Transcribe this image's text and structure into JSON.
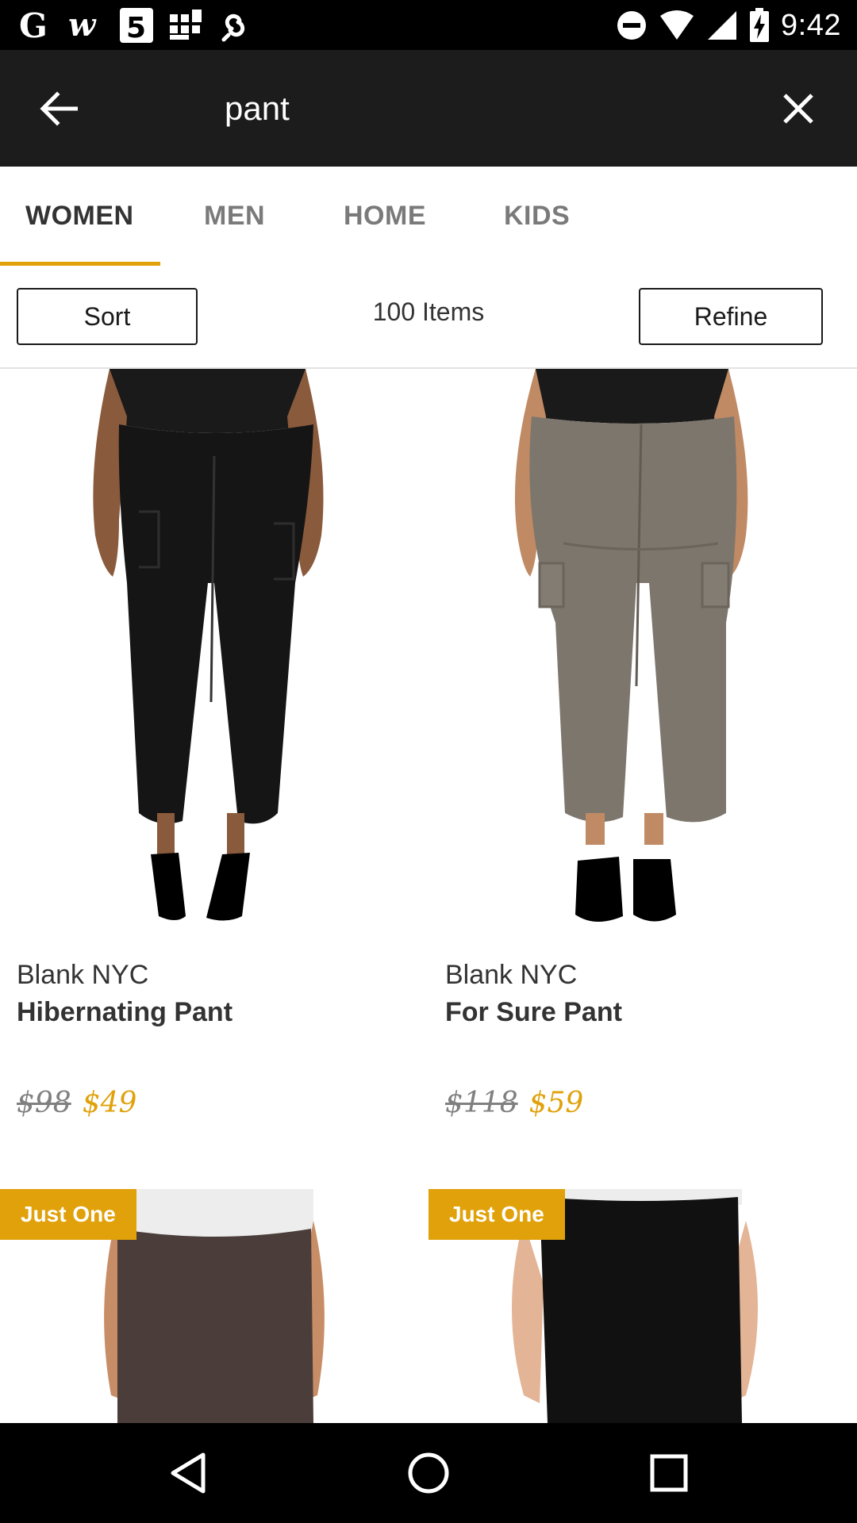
{
  "status_bar": {
    "time": "9:42",
    "left_icons": [
      "google-icon",
      "wordpress-icon",
      "channel5-icon",
      "grid-app-icon",
      "link-app-icon"
    ],
    "right_icons": [
      "do-not-disturb-icon",
      "wifi-icon",
      "signal-icon",
      "battery-charging-icon"
    ]
  },
  "toolbar": {
    "query": "pant"
  },
  "tabs": [
    {
      "label": "WOMEN",
      "active": true
    },
    {
      "label": "MEN",
      "active": false
    },
    {
      "label": "HOME",
      "active": false
    },
    {
      "label": "KIDS",
      "active": false
    }
  ],
  "filter": {
    "sort_label": "Sort",
    "items_count": "100 Items",
    "refine_label": "Refine"
  },
  "products": [
    {
      "brand": "Blank NYC",
      "name": "Hibernating Pant",
      "original_price": "$98",
      "sale_price": "$49"
    },
    {
      "brand": "Blank NYC",
      "name": "For Sure Pant",
      "original_price": "$118",
      "sale_price": "$59"
    }
  ],
  "products_row2": [
    {
      "badge": "Just One"
    },
    {
      "badge": "Just One"
    }
  ],
  "colors": {
    "accent": "#e0a10a",
    "toolbar": "#1c1c1c"
  }
}
